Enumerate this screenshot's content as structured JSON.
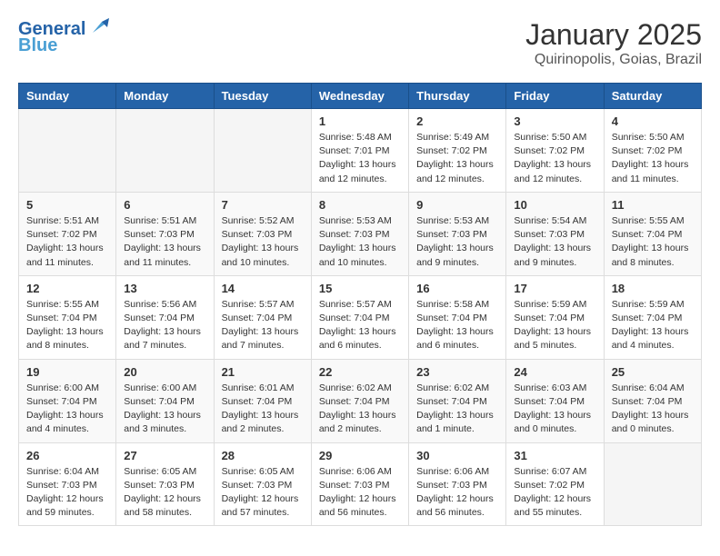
{
  "logo": {
    "line1": "General",
    "line2": "Blue"
  },
  "title": "January 2025",
  "subtitle": "Quirinopolis, Goias, Brazil",
  "days_of_week": [
    "Sunday",
    "Monday",
    "Tuesday",
    "Wednesday",
    "Thursday",
    "Friday",
    "Saturday"
  ],
  "weeks": [
    [
      {
        "day": "",
        "info": ""
      },
      {
        "day": "",
        "info": ""
      },
      {
        "day": "",
        "info": ""
      },
      {
        "day": "1",
        "info": "Sunrise: 5:48 AM\nSunset: 7:01 PM\nDaylight: 13 hours and 12 minutes."
      },
      {
        "day": "2",
        "info": "Sunrise: 5:49 AM\nSunset: 7:02 PM\nDaylight: 13 hours and 12 minutes."
      },
      {
        "day": "3",
        "info": "Sunrise: 5:50 AM\nSunset: 7:02 PM\nDaylight: 13 hours and 12 minutes."
      },
      {
        "day": "4",
        "info": "Sunrise: 5:50 AM\nSunset: 7:02 PM\nDaylight: 13 hours and 11 minutes."
      }
    ],
    [
      {
        "day": "5",
        "info": "Sunrise: 5:51 AM\nSunset: 7:02 PM\nDaylight: 13 hours and 11 minutes."
      },
      {
        "day": "6",
        "info": "Sunrise: 5:51 AM\nSunset: 7:03 PM\nDaylight: 13 hours and 11 minutes."
      },
      {
        "day": "7",
        "info": "Sunrise: 5:52 AM\nSunset: 7:03 PM\nDaylight: 13 hours and 10 minutes."
      },
      {
        "day": "8",
        "info": "Sunrise: 5:53 AM\nSunset: 7:03 PM\nDaylight: 13 hours and 10 minutes."
      },
      {
        "day": "9",
        "info": "Sunrise: 5:53 AM\nSunset: 7:03 PM\nDaylight: 13 hours and 9 minutes."
      },
      {
        "day": "10",
        "info": "Sunrise: 5:54 AM\nSunset: 7:03 PM\nDaylight: 13 hours and 9 minutes."
      },
      {
        "day": "11",
        "info": "Sunrise: 5:55 AM\nSunset: 7:04 PM\nDaylight: 13 hours and 8 minutes."
      }
    ],
    [
      {
        "day": "12",
        "info": "Sunrise: 5:55 AM\nSunset: 7:04 PM\nDaylight: 13 hours and 8 minutes."
      },
      {
        "day": "13",
        "info": "Sunrise: 5:56 AM\nSunset: 7:04 PM\nDaylight: 13 hours and 7 minutes."
      },
      {
        "day": "14",
        "info": "Sunrise: 5:57 AM\nSunset: 7:04 PM\nDaylight: 13 hours and 7 minutes."
      },
      {
        "day": "15",
        "info": "Sunrise: 5:57 AM\nSunset: 7:04 PM\nDaylight: 13 hours and 6 minutes."
      },
      {
        "day": "16",
        "info": "Sunrise: 5:58 AM\nSunset: 7:04 PM\nDaylight: 13 hours and 6 minutes."
      },
      {
        "day": "17",
        "info": "Sunrise: 5:59 AM\nSunset: 7:04 PM\nDaylight: 13 hours and 5 minutes."
      },
      {
        "day": "18",
        "info": "Sunrise: 5:59 AM\nSunset: 7:04 PM\nDaylight: 13 hours and 4 minutes."
      }
    ],
    [
      {
        "day": "19",
        "info": "Sunrise: 6:00 AM\nSunset: 7:04 PM\nDaylight: 13 hours and 4 minutes."
      },
      {
        "day": "20",
        "info": "Sunrise: 6:00 AM\nSunset: 7:04 PM\nDaylight: 13 hours and 3 minutes."
      },
      {
        "day": "21",
        "info": "Sunrise: 6:01 AM\nSunset: 7:04 PM\nDaylight: 13 hours and 2 minutes."
      },
      {
        "day": "22",
        "info": "Sunrise: 6:02 AM\nSunset: 7:04 PM\nDaylight: 13 hours and 2 minutes."
      },
      {
        "day": "23",
        "info": "Sunrise: 6:02 AM\nSunset: 7:04 PM\nDaylight: 13 hours and 1 minute."
      },
      {
        "day": "24",
        "info": "Sunrise: 6:03 AM\nSunset: 7:04 PM\nDaylight: 13 hours and 0 minutes."
      },
      {
        "day": "25",
        "info": "Sunrise: 6:04 AM\nSunset: 7:04 PM\nDaylight: 13 hours and 0 minutes."
      }
    ],
    [
      {
        "day": "26",
        "info": "Sunrise: 6:04 AM\nSunset: 7:03 PM\nDaylight: 12 hours and 59 minutes."
      },
      {
        "day": "27",
        "info": "Sunrise: 6:05 AM\nSunset: 7:03 PM\nDaylight: 12 hours and 58 minutes."
      },
      {
        "day": "28",
        "info": "Sunrise: 6:05 AM\nSunset: 7:03 PM\nDaylight: 12 hours and 57 minutes."
      },
      {
        "day": "29",
        "info": "Sunrise: 6:06 AM\nSunset: 7:03 PM\nDaylight: 12 hours and 56 minutes."
      },
      {
        "day": "30",
        "info": "Sunrise: 6:06 AM\nSunset: 7:03 PM\nDaylight: 12 hours and 56 minutes."
      },
      {
        "day": "31",
        "info": "Sunrise: 6:07 AM\nSunset: 7:02 PM\nDaylight: 12 hours and 55 minutes."
      },
      {
        "day": "",
        "info": ""
      }
    ]
  ]
}
